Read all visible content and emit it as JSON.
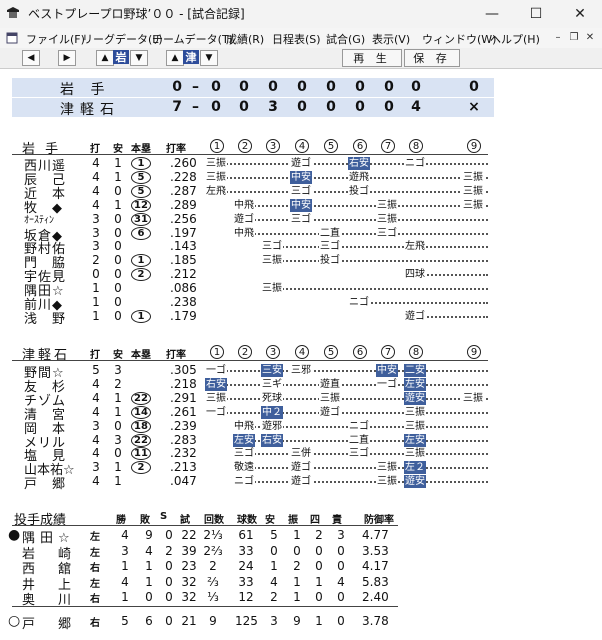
{
  "window": {
    "title": "ベストプレープロ野球’００ - [試合記録]",
    "minimize": "—",
    "maximize": "☐",
    "close": "✕"
  },
  "menu": {
    "items": [
      "ファイル(F)",
      "リーグデータ(L)",
      "チームデータ(T)",
      "成績(R)",
      "日程表(S)",
      "試合(G)",
      "表示(V)",
      "ウィンドウ(W)",
      "ヘルプ(H)"
    ]
  },
  "toolbar": {
    "team1": "岩",
    "team2": "津",
    "play": "再 生",
    "save": "保 存"
  },
  "scoreboard": [
    {
      "team": "岩 手",
      "total": "0",
      "innings": [
        "0",
        "0",
        "0",
        "0",
        "0",
        "0",
        "0",
        "0",
        "0"
      ]
    },
    {
      "team": "津軽石",
      "total": "7",
      "innings": [
        "0",
        "0",
        "3",
        "0",
        "0",
        "0",
        "0",
        "4",
        "×"
      ]
    }
  ],
  "headers": {
    "ab": "打",
    "h": "安",
    "hr": "本塁",
    "avg": "打率",
    "innings": [
      "①",
      "②",
      "③",
      "④",
      "⑤",
      "⑥",
      "⑦",
      "⑧",
      "⑨"
    ]
  },
  "batting_home": {
    "team": "岩 手",
    "rows": [
      {
        "name": "西川遥",
        "ab": "4",
        "h": "1",
        "hr": "1",
        "avg": ".260"
      },
      {
        "name": "辰　己",
        "ab": "4",
        "h": "1",
        "hr": "5",
        "avg": ".228"
      },
      {
        "name": "近　本",
        "ab": "4",
        "h": "0",
        "hr": "5",
        "avg": ".287"
      },
      {
        "name": "牧　◆",
        "ab": "4",
        "h": "1",
        "hr": "12",
        "avg": ".289"
      },
      {
        "name": "ｵｰｽﾃｨﾝ",
        "ab": "3",
        "h": "0",
        "hr": "31",
        "avg": ".256"
      },
      {
        "name": "坂倉◆",
        "ab": "3",
        "h": "0",
        "hr": "6",
        "avg": ".197"
      },
      {
        "name": "野村佑",
        "ab": "3",
        "h": "0",
        "hr": "",
        "avg": ".143"
      },
      {
        "name": "門　脇",
        "ab": "2",
        "h": "0",
        "hr": "1",
        "avg": ".185"
      },
      {
        "name": "宇佐見",
        "ab": "0",
        "h": "0",
        "hr": "2",
        "avg": ".212"
      },
      {
        "name": "隅田☆",
        "ab": "1",
        "h": "0",
        "hr": "",
        "avg": ".086"
      },
      {
        "name": "前川◆",
        "ab": "1",
        "h": "0",
        "hr": "",
        "avg": ".238"
      },
      {
        "name": "浅　野",
        "ab": "1",
        "h": "0",
        "hr": "1",
        "avg": ".179"
      }
    ]
  },
  "batting_away": {
    "team": "津軽石",
    "rows": [
      {
        "name": "野間☆",
        "ab": "5",
        "h": "3",
        "hr": "",
        "avg": ".305"
      },
      {
        "name": "友　杉",
        "ab": "4",
        "h": "2",
        "hr": "",
        "avg": ".218"
      },
      {
        "name": "チゾム",
        "ab": "4",
        "h": "1",
        "hr": "22",
        "avg": ".291"
      },
      {
        "name": "清　宮",
        "ab": "4",
        "h": "1",
        "hr": "14",
        "avg": ".261"
      },
      {
        "name": "岡　本",
        "ab": "3",
        "h": "0",
        "hr": "18",
        "avg": ".239"
      },
      {
        "name": "メリル",
        "ab": "4",
        "h": "3",
        "hr": "22",
        "avg": ".283"
      },
      {
        "name": "塩　見",
        "ab": "4",
        "h": "0",
        "hr": "11",
        "avg": ".232"
      },
      {
        "name": "山本祐☆",
        "ab": "3",
        "h": "1",
        "hr": "2",
        "avg": ".213"
      },
      {
        "name": "戸　郷",
        "ab": "4",
        "h": "1",
        "hr": "",
        "avg": ".047"
      }
    ]
  },
  "results_home": [
    [
      [
        0,
        "三振"
      ],
      [
        3,
        "遊ゴ"
      ],
      [
        5,
        "右安",
        true
      ],
      [
        7,
        "ニゴ"
      ]
    ],
    [
      [
        0,
        "三振"
      ],
      [
        3,
        "中安",
        true
      ],
      [
        5,
        "遊飛"
      ],
      [
        8,
        "三振"
      ]
    ],
    [
      [
        0,
        "左飛"
      ],
      [
        3,
        "三ゴ"
      ],
      [
        5,
        "投ゴ"
      ],
      [
        8,
        "三振"
      ]
    ],
    [
      [
        1,
        "中飛"
      ],
      [
        3,
        "中安",
        true
      ],
      [
        6,
        "三振"
      ],
      [
        8,
        "三振"
      ]
    ],
    [
      [
        1,
        "遊ゴ"
      ],
      [
        3,
        "三ゴ"
      ],
      [
        6,
        "三振"
      ]
    ],
    [
      [
        1,
        "中飛"
      ],
      [
        4,
        "二直"
      ],
      [
        6,
        "三ゴ"
      ]
    ],
    [
      [
        2,
        "三ゴ"
      ],
      [
        4,
        "三ゴ"
      ],
      [
        7,
        "左飛"
      ]
    ],
    [
      [
        2,
        "三振"
      ],
      [
        4,
        "投ゴ"
      ]
    ],
    [
      [
        7,
        "四球"
      ]
    ],
    [
      [
        2,
        "三振"
      ]
    ],
    [
      [
        5,
        "ニゴ"
      ]
    ],
    [
      [
        7,
        "遊ゴ"
      ]
    ]
  ],
  "results_away": [
    [
      [
        0,
        "一ゴ"
      ],
      [
        2,
        "三安",
        true
      ],
      [
        3,
        "三邪"
      ],
      [
        6,
        "中安",
        true
      ],
      [
        7,
        "二安",
        true
      ]
    ],
    [
      [
        0,
        "右安",
        true
      ],
      [
        2,
        "三ギ"
      ],
      [
        4,
        "遊直"
      ],
      [
        6,
        "一ゴ"
      ],
      [
        7,
        "左安",
        true
      ]
    ],
    [
      [
        0,
        "三振"
      ],
      [
        2,
        "死球"
      ],
      [
        4,
        "三振"
      ],
      [
        7,
        "遊安",
        true
      ],
      [
        8,
        "三振"
      ]
    ],
    [
      [
        0,
        "一ゴ"
      ],
      [
        2,
        "中２",
        true
      ],
      [
        4,
        "遊ゴ"
      ],
      [
        7,
        "三振"
      ]
    ],
    [
      [
        1,
        "中飛"
      ],
      [
        2,
        "遊邪"
      ],
      [
        5,
        "ニゴ"
      ],
      [
        7,
        "三振"
      ]
    ],
    [
      [
        1,
        "左安",
        true
      ],
      [
        2,
        "右安",
        true
      ],
      [
        5,
        "二直"
      ],
      [
        7,
        "左安",
        true
      ]
    ],
    [
      [
        1,
        "三ゴ"
      ],
      [
        3,
        "三併"
      ],
      [
        5,
        "三ゴ"
      ],
      [
        7,
        "三振"
      ]
    ],
    [
      [
        1,
        "敬遠"
      ],
      [
        3,
        "遊ゴ"
      ],
      [
        6,
        "三振"
      ],
      [
        7,
        "左２",
        true
      ]
    ],
    [
      [
        1,
        "ニゴ"
      ],
      [
        3,
        "遊ゴ"
      ],
      [
        6,
        "三振"
      ],
      [
        7,
        "遊安",
        true
      ]
    ]
  ],
  "pitching": {
    "title": "投手成績",
    "headers": [
      "勝",
      "敗",
      "S",
      "試",
      "回数",
      "球数",
      "安",
      "振",
      "四",
      "責",
      "防御率"
    ],
    "rows": [
      {
        "mark": "●",
        "name": "隅田☆",
        "hand": "左",
        "vals": [
          "4",
          "9",
          "0",
          "22",
          "2⅓",
          "61",
          "5",
          "1",
          "2",
          "3",
          "4.77"
        ]
      },
      {
        "mark": "",
        "name": "岩　崎",
        "hand": "左",
        "vals": [
          "3",
          "4",
          "2",
          "39",
          "2⅔",
          "33",
          "0",
          "0",
          "0",
          "0",
          "3.53"
        ]
      },
      {
        "mark": "",
        "name": "西　舘",
        "hand": "右",
        "vals": [
          "1",
          "1",
          "0",
          "23",
          "2",
          "24",
          "1",
          "2",
          "0",
          "0",
          "4.17"
        ]
      },
      {
        "mark": "",
        "name": "井　上",
        "hand": "左",
        "vals": [
          "4",
          "1",
          "0",
          "32",
          "⅔",
          "33",
          "4",
          "1",
          "1",
          "4",
          "5.83"
        ]
      },
      {
        "mark": "",
        "name": "奥　川",
        "hand": "右",
        "vals": [
          "1",
          "0",
          "0",
          "32",
          "⅓",
          "12",
          "2",
          "1",
          "0",
          "0",
          "2.40"
        ]
      },
      {
        "mark": "○",
        "name": "戸　郷",
        "hand": "右",
        "vals": [
          "5",
          "6",
          "0",
          "21",
          "9",
          "125",
          "3",
          "9",
          "1",
          "0",
          "3.78"
        ]
      }
    ]
  }
}
